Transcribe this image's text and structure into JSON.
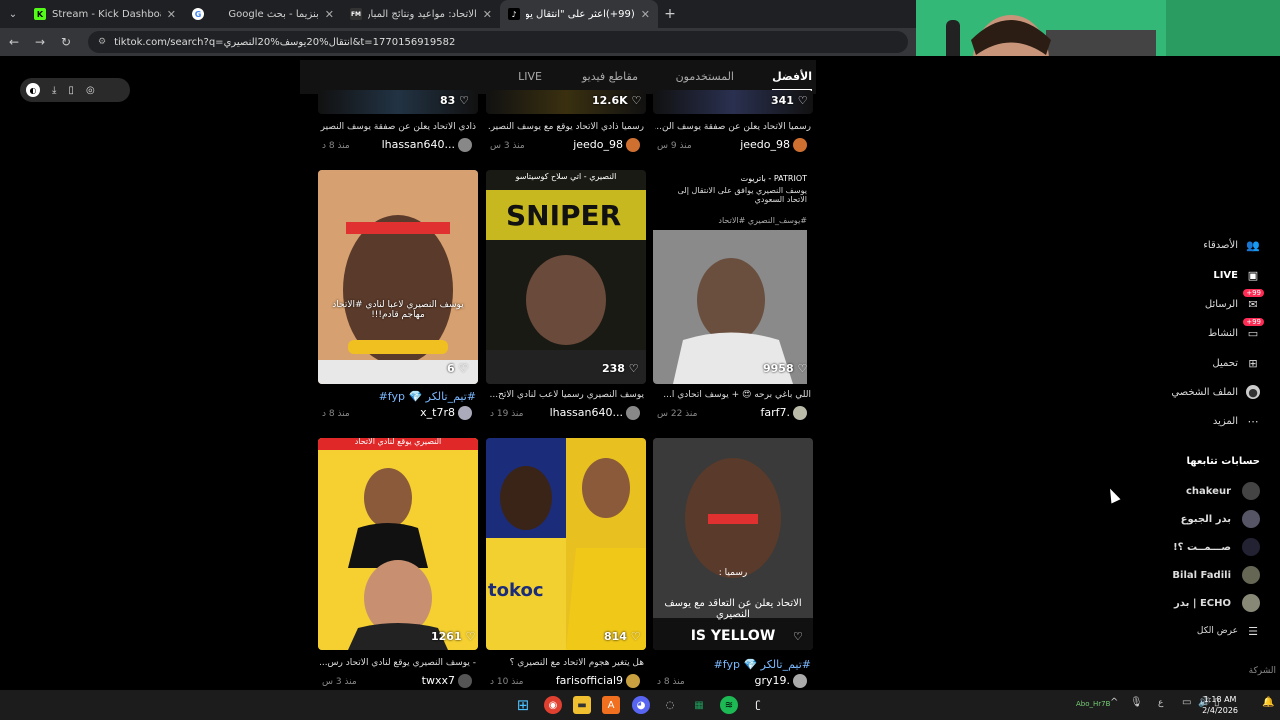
{
  "browser": {
    "tabs": [
      {
        "title": "Stream - Kick Dashboard",
        "fav": "K",
        "color": "#53fc18"
      },
      {
        "title": "بنزيما - بحث Google",
        "fav": "G",
        "color": "#ffffff"
      },
      {
        "title": "الاتحاد: مواعيد ونتائج المباريات -",
        "fav": "FM",
        "color": "#333333"
      },
      {
        "title": "(99+)اعثر على \"انتقال يوسف النـ",
        "fav": "♪",
        "color": "#000000"
      }
    ],
    "url": "tiktok.com/search?q=انتقال%20يوسف%20النصيري&t=1770156919582",
    "new_tab": "+"
  },
  "search_tabs": [
    "الأفضل",
    "المستخدمون",
    "مقاطع فيديو",
    "LIVE"
  ],
  "videos": [
    {
      "likes": "83",
      "desc": "ذادي الاتحاد يعلن عن صفقة يوسف النصيري ...",
      "time": "منذ 8 د",
      "user": "lhassan640..."
    },
    {
      "likes": "12.6K",
      "desc": "رسميا ذادي الاتحاد يوقع مع يوسف النصير...",
      "time": "منذ 3 س",
      "user": "jeedo_98"
    },
    {
      "likes": "341",
      "desc": "رسميا الاتحاد يعلن عن صفقة يوسف الن...",
      "time": "منذ 9 س",
      "user": "jeedo_98"
    },
    {
      "likes": "6",
      "desc": "#تيم_تالكر 💎 fyp#",
      "time": "منذ 8 د",
      "user": "x_t7r8"
    },
    {
      "likes": "238",
      "desc": "يوسف النصيري رسميا لاعب لنادي الاتح...",
      "time": "منذ 19 د",
      "user": "lhassan640..."
    },
    {
      "likes": "9958",
      "desc": "اللي باغي برحه 😍 + يوسف اتحادي ا...",
      "time": "منذ 22 س",
      "user": "farf7."
    },
    {
      "likes": "1261",
      "desc": "- يوسف النصيري يوقع لنادي الاتحاد رس...",
      "time": "منذ 3 س",
      "user": "twxx7"
    },
    {
      "likes": "814",
      "desc": "هل يتغير هجوم الاتحاد مع النصيري ؟",
      "time": "منذ 10 د",
      "user": "farisofficial9"
    },
    {
      "likes": "",
      "desc": "#تيم_تالكر 💎 fyp#",
      "time": "منذ 8 د",
      "user": "gry19."
    }
  ],
  "thumb_texts": {
    "t4_main": "يوسف النصيري لاعبا لنادي #الاتحاد مهاجم قادم!!!",
    "t5_main": "النصيري - اتي سلاح كوسيتاسو",
    "t6_head": "PATRIOT - باتريوت",
    "t6_sub": "يوسف النصيري يوافق على الانتقال إلى الاتحاد السعودي",
    "t6_tag": "#يوسف_النصيري #الاتحاد",
    "t7_banner": "النصيري يوقع لنادي الاتحاد",
    "t8_text": "tokoc",
    "t9_main": "الاتحاد يعلن عن التعاقد مع يوسف النصيري",
    "t9_banner": "IS YELLOW",
    "t9_sub": "رسميا :"
  },
  "right_nav": [
    {
      "label": "الأصدقاء",
      "icon": "friends-icon",
      "badge": ""
    },
    {
      "label": "LIVE",
      "icon": "live-icon",
      "badge": ""
    },
    {
      "label": "الرسائل",
      "icon": "messages-icon",
      "badge": "99+"
    },
    {
      "label": "النشاط",
      "icon": "activity-icon",
      "badge": "99+"
    },
    {
      "label": "تحميل",
      "icon": "upload-icon",
      "badge": ""
    },
    {
      "label": "الملف الشخصي",
      "icon": "profile-icon",
      "badge": ""
    },
    {
      "label": "المزيد",
      "icon": "more-icon",
      "badge": ""
    }
  ],
  "following": {
    "title": "حسابات تتابعها",
    "accounts": [
      "chakeur",
      "بدر الجبوع",
      "صـــمــت ؟!",
      "Bilal Fadili",
      "ECHO | بدر"
    ],
    "see_all": "عرض الكل"
  },
  "footer_company": "الشركة",
  "taskbar": {
    "user": "Abo_Hr7B",
    "lang": "ع",
    "time": "1:18 AM",
    "date": "2/4/2026"
  }
}
